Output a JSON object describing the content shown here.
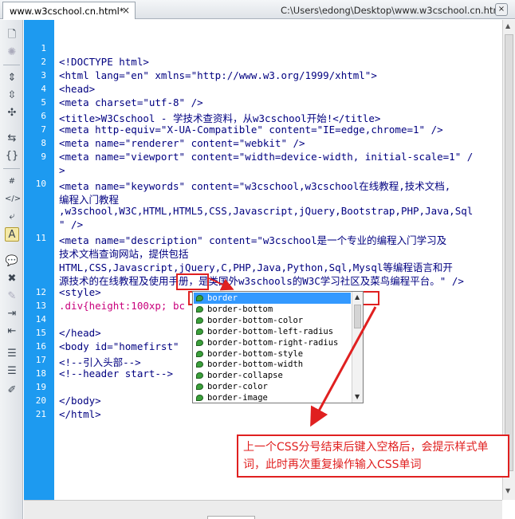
{
  "tab": {
    "title": "www.w3cschool.cn.html*",
    "close": "×"
  },
  "filepath": "C:\\Users\\edong\\Desktop\\www.w3cschool.cn.html",
  "window_close": "×",
  "toolbar_icons": [
    "file-icon",
    "gear-icon",
    "expand-icon",
    "collapse-icon",
    "tree-icon",
    "code-nav-icon",
    "braces-icon",
    "hash-icon",
    "tag-icon",
    "wrap-icon",
    "highlight-icon",
    "comment-icon",
    "uncomment-icon",
    "pencil-icon",
    "indent-icon",
    "outdent-icon",
    "list-icon",
    "brush-icon"
  ],
  "line_numbers": [
    "1",
    "2",
    "3",
    "4",
    "5",
    "6",
    "7",
    "8",
    "9",
    "10",
    "",
    "",
    "11",
    "",
    "",
    "",
    "12",
    "13",
    "14",
    "15",
    "16",
    "17",
    "18",
    "19",
    "20",
    "21"
  ],
  "code_lines": [
    "",
    "<!DOCTYPE html>",
    "<html lang=\"en\" xmlns=\"http://www.w3.org/1999/xhtml\">",
    "<head>",
    "<meta charset=\"utf-8\" />",
    "<title>W3Cschool - 学技术查资料，从w3cschool开始!</title>",
    "<meta http-equiv=\"X-UA-Compatible\" content=\"IE=edge,chrome=1\" />",
    "<meta name=\"renderer\" content=\"webkit\" />",
    "<meta name=\"viewport\" content=\"width=device-width, initial-scale=1\" /",
    ">",
    "<meta name=\"keywords\" content=\"w3cschool,w3cschool在线教程,技术文档,",
    "编程入门教程",
    ",w3school,W3C,HTML,HTML5,CSS,Javascript,jQuery,Bootstrap,PHP,Java,Sql",
    "\" />",
    "<meta name=\"description\" content=\"w3cschool是一个专业的编程入门学习及",
    "技术文档查询网站，提供包括",
    "HTML,CSS,Javascript,jQuery,C,PHP,Java,Python,Sql,Mysql等编程语言和开",
    "源技术的在线教程及使用手册，是类国外w3schools的W3C学习社区及菜鸟编程平台。\" />",
    "<style>",
    ".div{height:100xp; bc",
    "",
    "</head>",
    "<body id=\"homefirst\"",
    "<!--引入头部-->",
    "<!--header start-->",
    "",
    "</body>",
    "</html>"
  ],
  "autocomplete": {
    "items": [
      "border",
      "border-bottom",
      "border-bottom-color",
      "border-bottom-left-radius",
      "border-bottom-right-radius",
      "border-bottom-style",
      "border-bottom-width",
      "border-collapse",
      "border-color",
      "border-image"
    ],
    "selected_index": 0
  },
  "annotation": "上一个CSS分号结束后键入空格后，会提示样式单词，此时再次重复操作输入CSS单词",
  "colors": {
    "gutter": "#1d9af0",
    "highlight": "#e02020",
    "selection": "#3399ff",
    "tag": "#000080",
    "css": "#c8007c"
  }
}
